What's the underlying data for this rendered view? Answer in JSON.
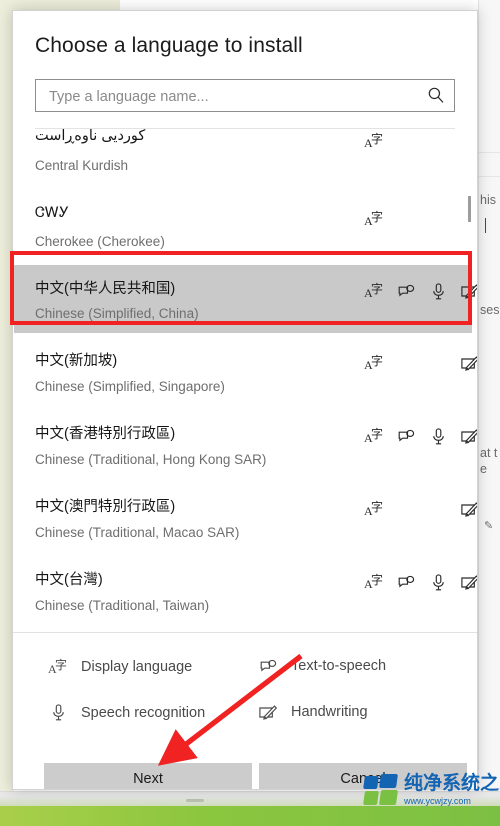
{
  "dialog": {
    "title": "Choose a language to install",
    "search": {
      "placeholder": "Type a language name...",
      "value": "",
      "icon": "search-icon"
    },
    "languages": [
      {
        "native": "کوردیی ناوەڕاست",
        "english": "Central Kurdish",
        "features": [
          "display-language"
        ],
        "selected": false
      },
      {
        "native": "ᏣᎳᎩ",
        "english": "Cherokee (Cherokee)",
        "features": [
          "display-language"
        ],
        "selected": false
      },
      {
        "native": "中文(中华人民共和国)",
        "english": "Chinese (Simplified, China)",
        "features": [
          "display-language",
          "text-to-speech",
          "speech-recognition",
          "handwriting"
        ],
        "selected": true
      },
      {
        "native": "中文(新加坡)",
        "english": "Chinese (Simplified, Singapore)",
        "features": [
          "display-language",
          "handwriting"
        ],
        "selected": false
      },
      {
        "native": "中文(香港特別行政區)",
        "english": "Chinese (Traditional, Hong Kong SAR)",
        "features": [
          "display-language",
          "text-to-speech",
          "speech-recognition",
          "handwriting"
        ],
        "selected": false
      },
      {
        "native": "中文(澳門特別行政區)",
        "english": "Chinese (Traditional, Macao SAR)",
        "features": [
          "display-language",
          "handwriting"
        ],
        "selected": false
      },
      {
        "native": "中文(台灣)",
        "english": "Chinese (Traditional, Taiwan)",
        "features": [
          "display-language",
          "text-to-speech",
          "speech-recognition",
          "handwriting"
        ],
        "selected": false
      }
    ],
    "legend": [
      {
        "icon": "display-language-icon",
        "label": "Display language"
      },
      {
        "icon": "text-to-speech-icon",
        "label": "Text-to-speech"
      },
      {
        "icon": "speech-recognition-icon",
        "label": "Speech recognition"
      },
      {
        "icon": "handwriting-icon",
        "label": "Handwriting"
      }
    ],
    "buttons": {
      "next": "Next",
      "cancel": "Cancel"
    }
  },
  "background": {
    "snippets": [
      "his",
      "ses",
      "at t",
      "e"
    ]
  },
  "watermark": {
    "name": "纯净系统之家",
    "url": "www.ycwjzy.com"
  },
  "colors": {
    "selected_row": "#c9c9c9",
    "annotation_red": "#f02222",
    "button_face": "#cccccc",
    "brand_blue": "#1464b4",
    "brand_green": "#7ac143"
  }
}
